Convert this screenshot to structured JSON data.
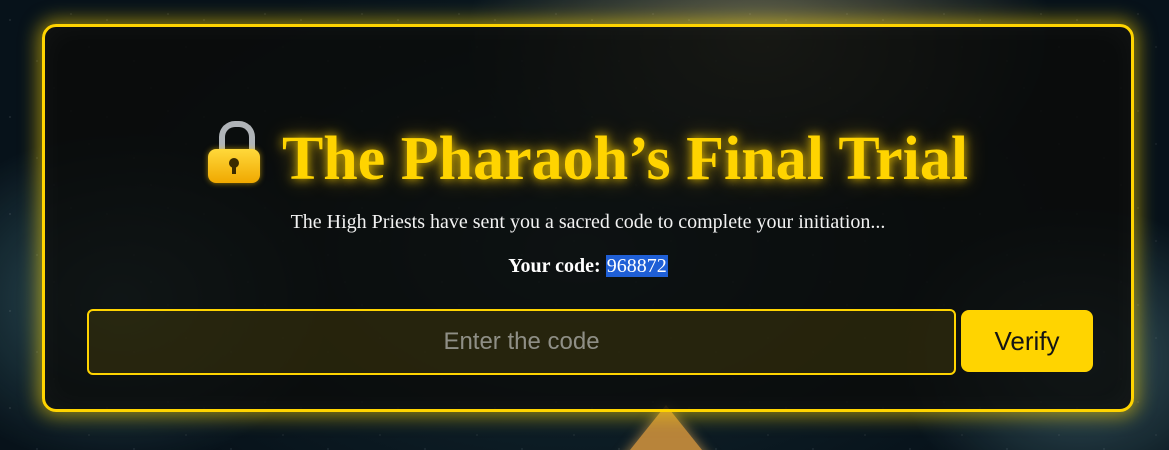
{
  "page": {
    "title": "The Pharaoh’s Final Trial",
    "title_icon": "lock-icon",
    "description": "The High Priests have sent you a sacred code to complete your initiation...",
    "code_label": "Your code:",
    "code_value": "968872"
  },
  "form": {
    "placeholder": "Enter the code",
    "value": "",
    "verify_label": "Verify"
  },
  "colors": {
    "accent": "#ffd400",
    "panel_background": "#0a0c0a",
    "selection_highlight": "#1f5fd6"
  }
}
